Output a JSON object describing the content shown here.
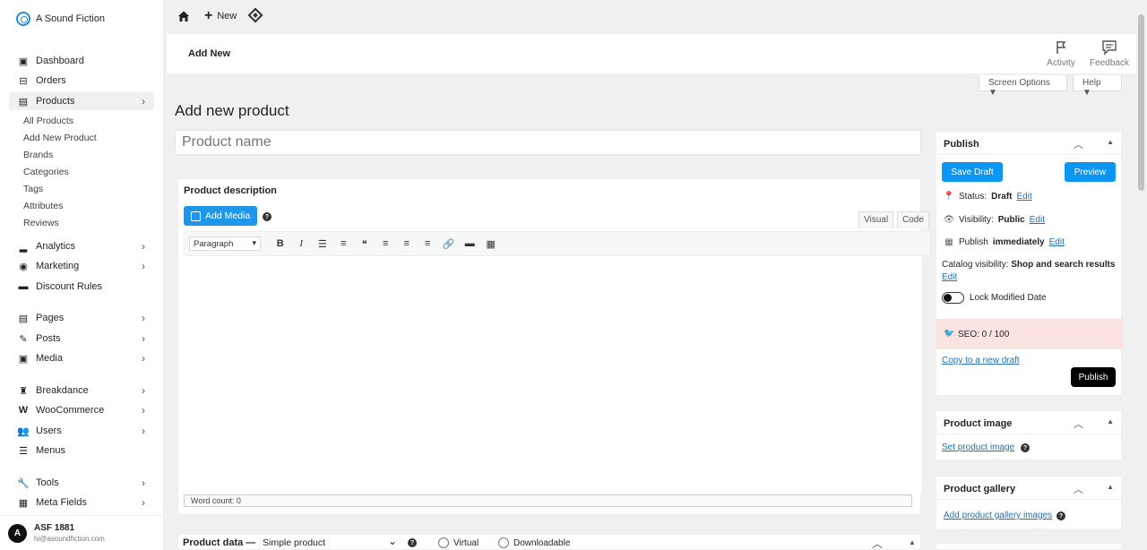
{
  "brand": {
    "name": "A Sound Fiction"
  },
  "sidebar": {
    "items": [
      {
        "label": "Dashboard",
        "icon": "dashboard-icon",
        "chevron": false
      },
      {
        "label": "Orders",
        "icon": "inbox-icon",
        "chevron": false
      },
      {
        "label": "Products",
        "icon": "archive-icon",
        "chevron": true
      },
      {
        "label": "Analytics",
        "icon": "bar-chart-icon",
        "chevron": true
      },
      {
        "label": "Marketing",
        "icon": "megaphone-icon",
        "chevron": true
      },
      {
        "label": "Discount Rules",
        "icon": "discount-icon",
        "chevron": false
      },
      {
        "label": "Pages",
        "icon": "pages-icon",
        "chevron": true
      },
      {
        "label": "Posts",
        "icon": "edit-icon",
        "chevron": true
      },
      {
        "label": "Media",
        "icon": "image-icon",
        "chevron": true
      },
      {
        "label": "Breakdance",
        "icon": "breakdance-icon",
        "chevron": true
      },
      {
        "label": "WooCommerce",
        "icon": "woocommerce-icon",
        "chevron": true
      },
      {
        "label": "Users",
        "icon": "users-icon",
        "chevron": true
      },
      {
        "label": "Menus",
        "icon": "menu-icon",
        "chevron": false
      },
      {
        "label": "Tools",
        "icon": "wrench-icon",
        "chevron": true
      },
      {
        "label": "Meta Fields",
        "icon": "table-icon",
        "chevron": true
      }
    ],
    "submenu": [
      "All Products",
      "Add New Product",
      "Brands",
      "Categories",
      "Tags",
      "Attributes",
      "Reviews"
    ]
  },
  "user": {
    "initial": "A",
    "name": "ASF 1881",
    "email": "hi@asoundfiction.com"
  },
  "topbar": {
    "new_label": "New"
  },
  "header": {
    "title": "Add New",
    "activity": "Activity",
    "feedback": "Feedback"
  },
  "screen_options": {
    "screen": "Screen Options ▼",
    "help": "Help ▼"
  },
  "page": {
    "heading": "Add new product",
    "name_placeholder": "Product name"
  },
  "description": {
    "title": "Product description",
    "add_media": "Add Media",
    "tab_visual": "Visual",
    "tab_code": "Code",
    "format": "Paragraph",
    "toolbar": [
      "B",
      "I",
      "☰",
      "≡",
      "❝",
      "≡",
      "≡",
      "≡",
      "🔗",
      "▬",
      "▦"
    ],
    "word_count": "Word count: 0"
  },
  "product_data": {
    "label": "Product data —",
    "type": "Simple product",
    "virtual": "Virtual",
    "downloadable": "Downloadable"
  },
  "publish": {
    "title": "Publish",
    "save_draft": "Save Draft",
    "preview": "Preview",
    "status_label": "Status:",
    "status_value": "Draft",
    "visibility_label": "Visibility:",
    "visibility_value": "Public",
    "publish_label": "Publish",
    "publish_value": "immediately",
    "edit": "Edit",
    "catalog_label": "Catalog visibility:",
    "catalog_value": "Shop and search results",
    "lock_label": "Lock Modified Date",
    "seo": "SEO: 0 / 100",
    "copy_draft": "Copy to a new draft",
    "publish_button": "Publish"
  },
  "product_image": {
    "title": "Product image",
    "link": "Set product image"
  },
  "product_gallery": {
    "title": "Product gallery",
    "link": "Add product gallery images"
  },
  "colors": {
    "accent": "#0a96f2",
    "seo_bg": "#fbe3e2"
  }
}
